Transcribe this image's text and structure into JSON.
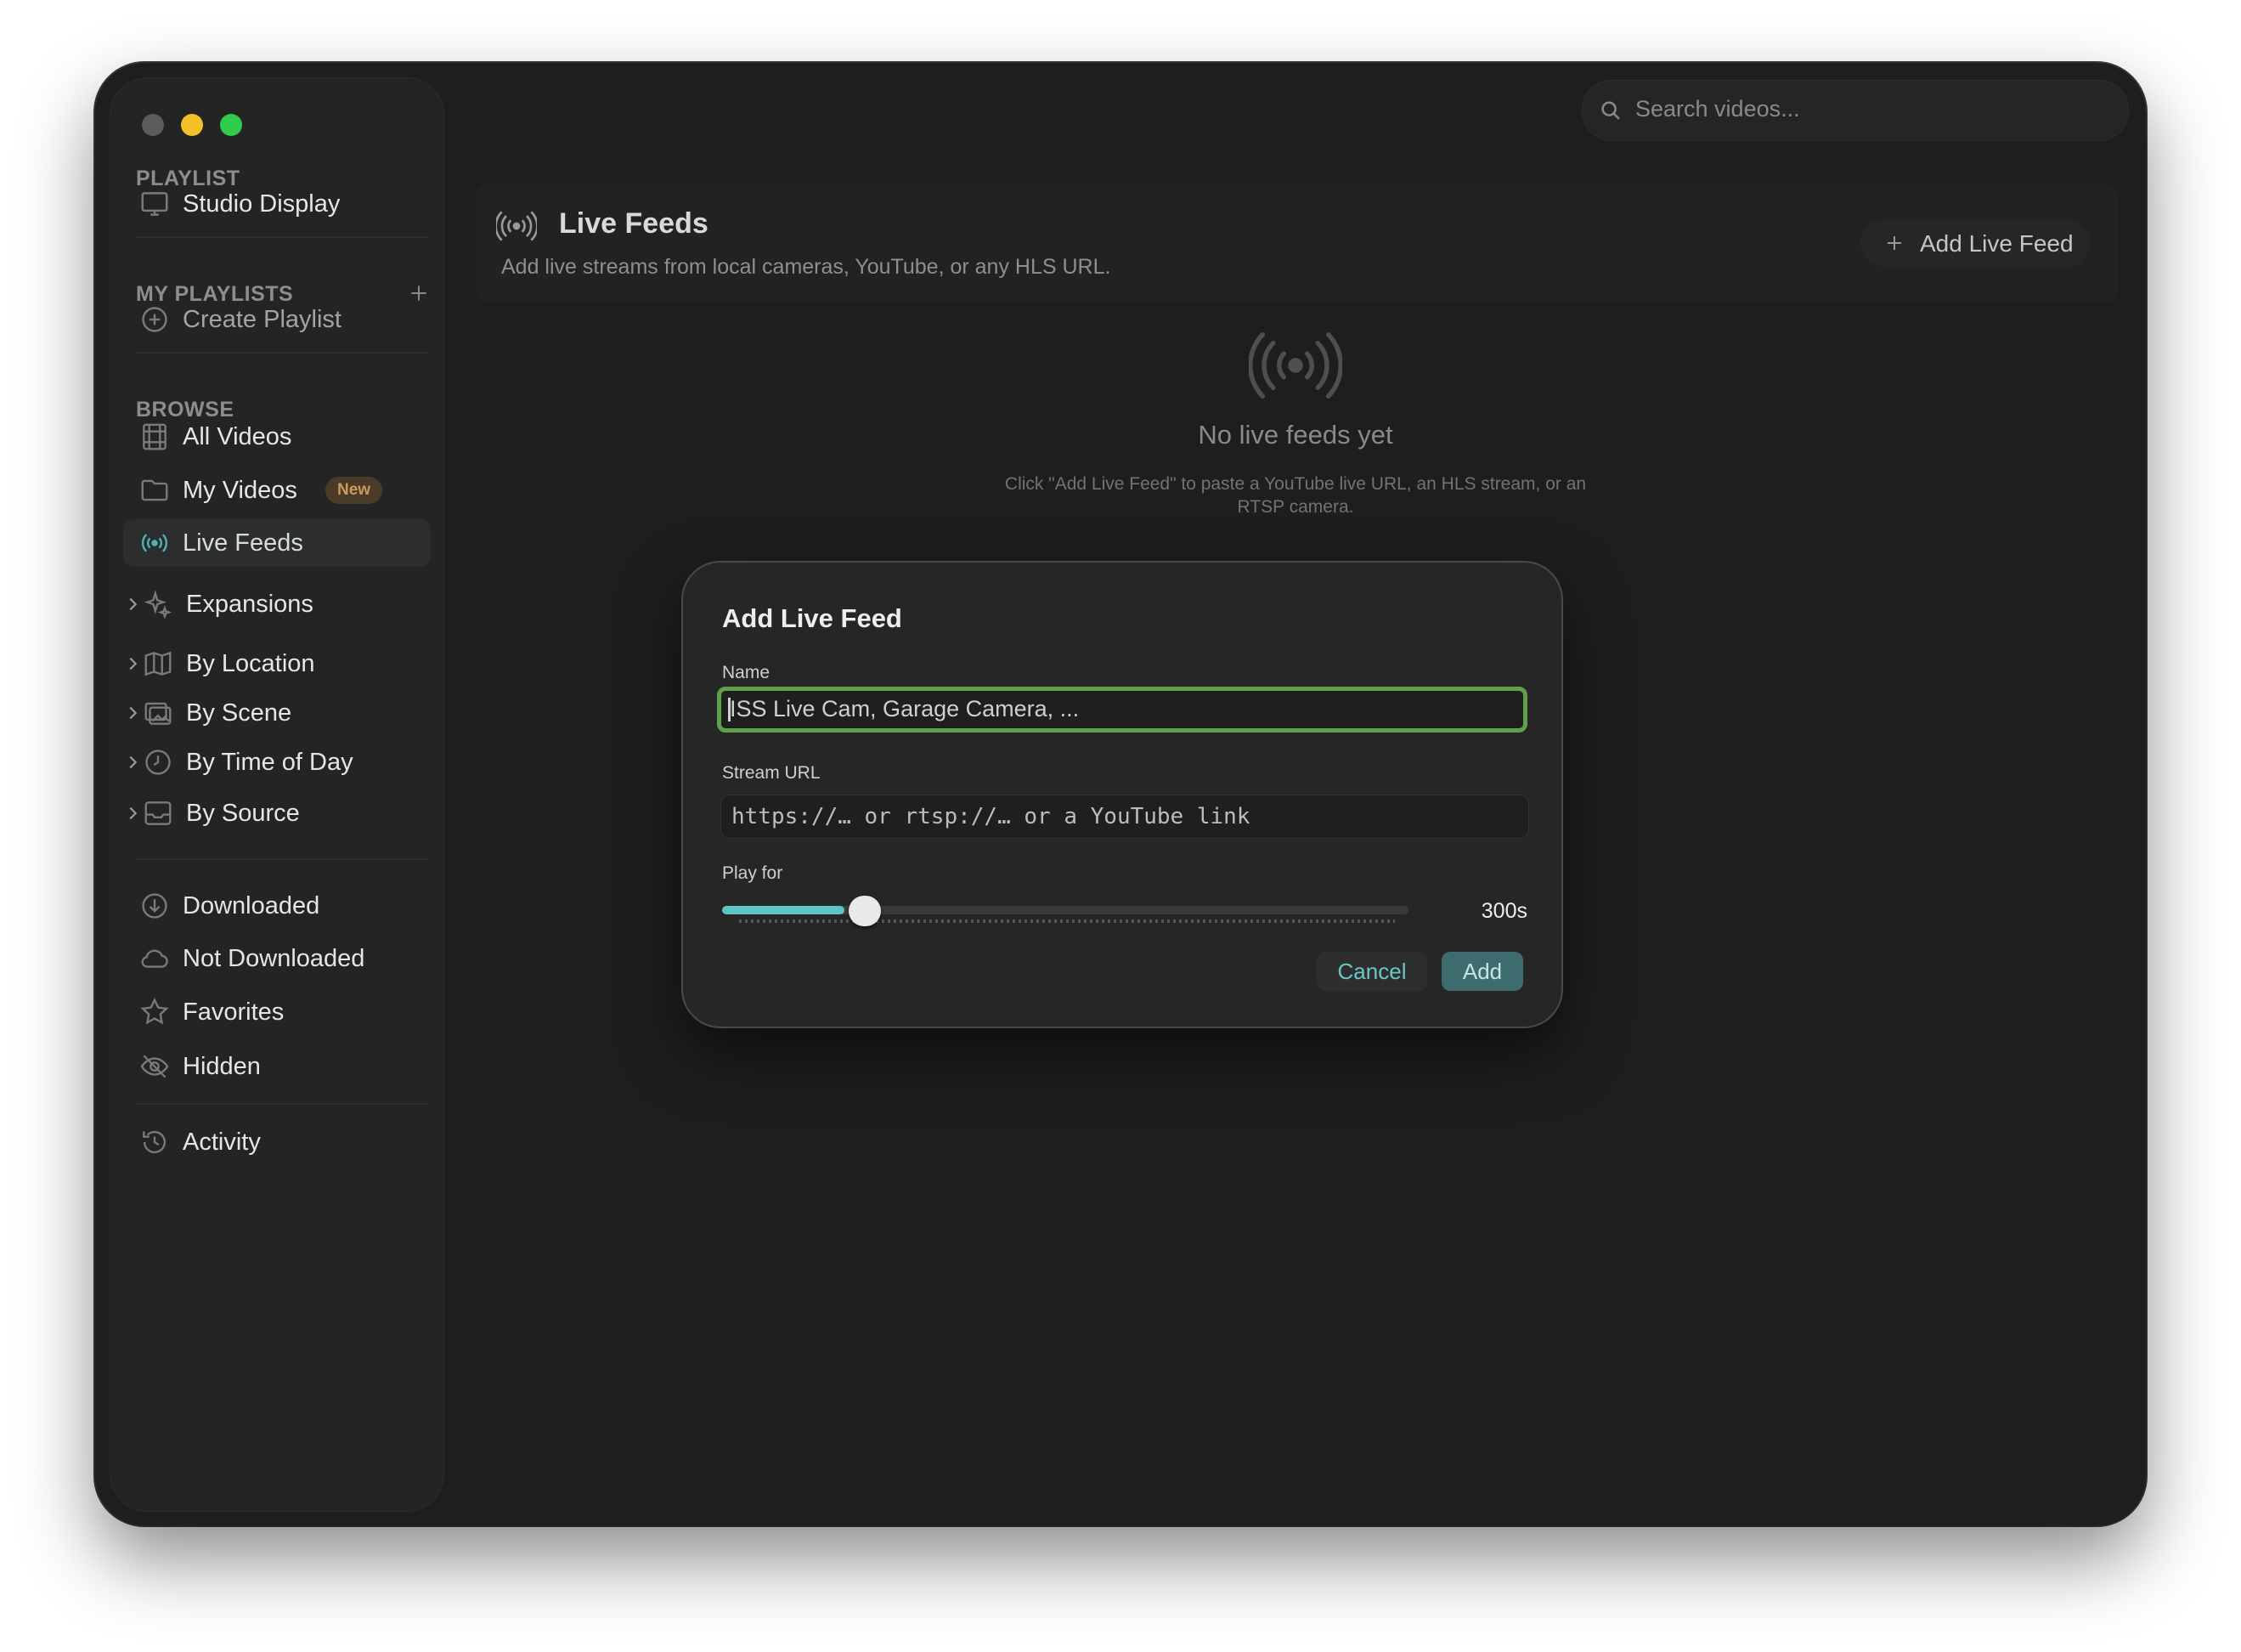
{
  "search": {
    "placeholder": "Search videos..."
  },
  "sidebar": {
    "playlist_section": "PLAYLIST",
    "studio_display": "Studio Display",
    "my_playlists_section": "MY PLAYLISTS",
    "create_playlist": "Create Playlist",
    "browse_section": "BROWSE",
    "all_videos": "All Videos",
    "my_videos": "My Videos",
    "new_badge": "New",
    "live_feeds": "Live Feeds",
    "expansions": "Expansions",
    "by_location": "By Location",
    "by_scene": "By Scene",
    "by_time_of_day": "By Time of Day",
    "by_source": "By Source",
    "downloaded": "Downloaded",
    "not_downloaded": "Not Downloaded",
    "favorites": "Favorites",
    "hidden": "Hidden",
    "activity": "Activity"
  },
  "header": {
    "title": "Live Feeds",
    "subtitle": "Add live streams from local cameras, YouTube, or any HLS URL.",
    "add_button": "Add Live Feed"
  },
  "empty_state": {
    "title": "No live feeds yet",
    "text": "Click \"Add Live Feed\" to paste a YouTube live URL, an HLS stream, or an RTSP camera."
  },
  "dialog": {
    "title": "Add Live Feed",
    "name_label": "Name",
    "name_placeholder": "ISS Live Cam, Garage Camera, ...",
    "url_label": "Stream URL",
    "url_placeholder": "https://… or rtsp://… or a YouTube link",
    "play_for_label": "Play for",
    "play_for_value": "300s",
    "slider_fraction": 0.178,
    "cancel": "Cancel",
    "add": "Add"
  },
  "colors": {
    "accent": "#5fc4c4",
    "focus_ring": "#5fa04a",
    "badge": "#c99a5b",
    "traffic_yellow": "#f5bf2a",
    "traffic_green": "#2fcb4a"
  }
}
